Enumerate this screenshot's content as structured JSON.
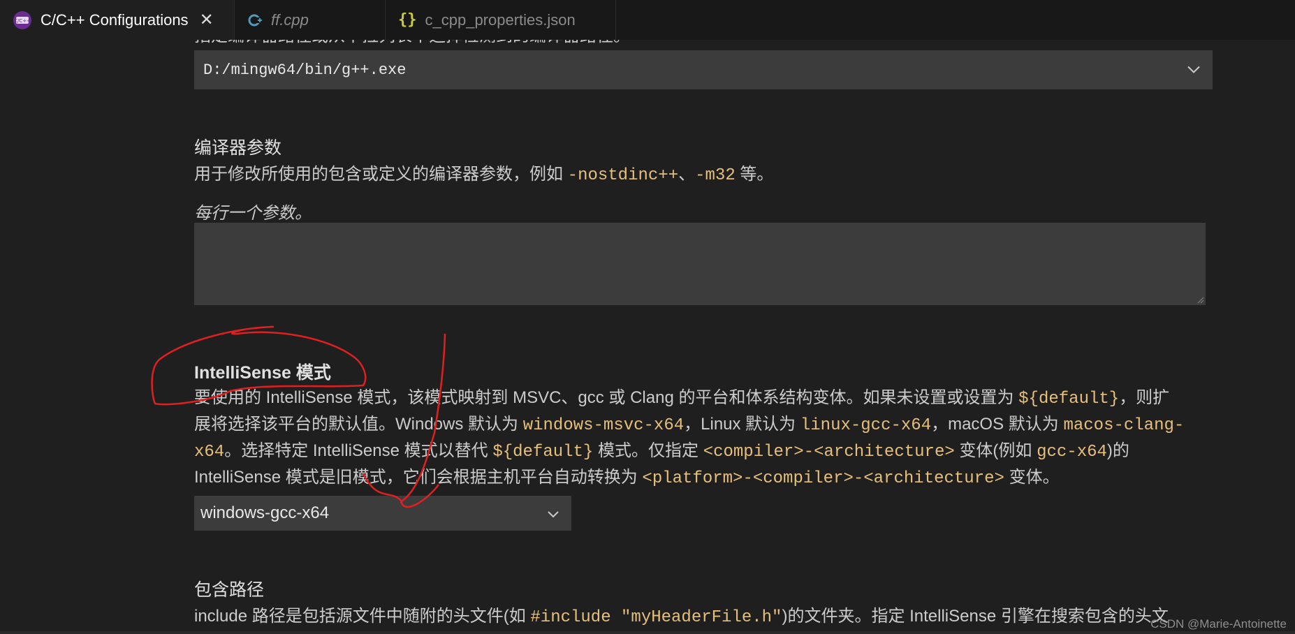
{
  "tabs": [
    {
      "label": "C/C++ Configurations",
      "icon": "cpp-extension-icon",
      "active": true,
      "close": "✕"
    },
    {
      "label": "ff.cpp",
      "icon": "cpp-file-icon",
      "active": false
    },
    {
      "label": "c_cpp_properties.json",
      "icon": "json-braces-icon",
      "active": false
    }
  ],
  "compiler_path": {
    "clipped_desc": "指定编译器路径或从下拉列表中选择检测到的编译器路径。",
    "value": "D:/mingw64/bin/g++.exe"
  },
  "compiler_args": {
    "title": "编译器参数",
    "desc_prefix": "用于修改所使用的包含或定义的编译器参数，例如 ",
    "code1": "-nostdinc++",
    "sep": "、",
    "code2": "-m32",
    "desc_suffix": " 等。",
    "hint": "每行一个参数。"
  },
  "intellisense": {
    "title": "IntelliSense 模式",
    "l1_a": "要使用的 IntelliSense 模式，该模式映射到 MSVC、gcc 或 Clang 的平台和体系结构变体。如果未设置或设置为 ",
    "l1_code": "${default}",
    "l1_b": "，则扩",
    "l2_a": "展将选择该平台的默认值。Windows 默认为 ",
    "l2_code1": "windows-msvc-x64",
    "l2_b": "，Linux 默认为 ",
    "l2_code2": "linux-gcc-x64",
    "l2_c": "，macOS 默认为 ",
    "l2_code3": "macos-clang-",
    "l3_code0": "x64",
    "l3_a": "。选择特定 IntelliSense 模式以替代 ",
    "l3_code1": "${default}",
    "l3_b": " 模式。仅指定 ",
    "l3_code2": "<compiler>-<architecture>",
    "l3_c": " 变体(例如 ",
    "l3_code3": "gcc-x64",
    "l3_d": ")的",
    "l4_a": "IntelliSense 模式是旧模式，它们会根据主机平台自动转换为 ",
    "l4_code": "<platform>-<compiler>-<architecture>",
    "l4_b": " 变体。",
    "value": "windows-gcc-x64"
  },
  "include_path": {
    "title": "包含路径",
    "desc_a": "include 路径是包括源文件中随附的头文件(如 ",
    "code": "#include \"myHeaderFile.h\"",
    "desc_b": ")的文件夹。指定 IntelliSense 引擎在搜索包含的头文"
  },
  "watermark": "CSDN @Marie-Antoinette",
  "colors": {
    "accent_code": "#e6c07b",
    "annotation": "#e02020"
  }
}
